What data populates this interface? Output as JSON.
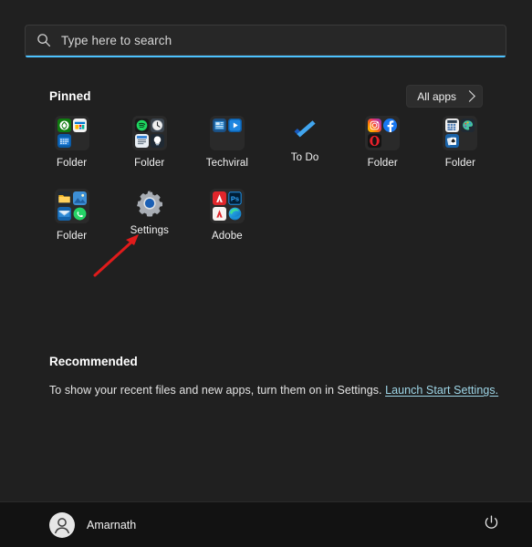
{
  "search": {
    "placeholder": "Type here to search",
    "icon": "search-icon",
    "accent_color": "#4cc2ff"
  },
  "pinned": {
    "title": "Pinned",
    "all_apps_label": "All apps",
    "all_apps_chevron": "chevron-right-icon",
    "tiles": [
      {
        "label": "Folder",
        "type": "folder",
        "icons": [
          "xbox",
          "microsoft-store",
          "calendar"
        ]
      },
      {
        "label": "Folder",
        "type": "folder",
        "icons": [
          "spotify",
          "clock",
          "sticky-notes",
          "tips"
        ]
      },
      {
        "label": "Techviral",
        "type": "folder",
        "icons": [
          "news",
          "media-player"
        ]
      },
      {
        "label": "To Do",
        "type": "app",
        "icon": "microsoft-todo"
      },
      {
        "label": "Folder",
        "type": "folder",
        "icons": [
          "instagram",
          "facebook",
          "opera"
        ]
      },
      {
        "label": "Folder",
        "type": "folder",
        "icons": [
          "calculator",
          "paint",
          "solitaire"
        ]
      },
      {
        "label": "Folder",
        "type": "folder",
        "icons": [
          "file-explorer",
          "photos",
          "mail",
          "whatsapp"
        ]
      },
      {
        "label": "Settings",
        "type": "app",
        "icon": "settings-gear"
      },
      {
        "label": "Adobe",
        "type": "folder",
        "icons": [
          "adobe-acrobat",
          "photoshop",
          "illustrator",
          "edge"
        ]
      }
    ]
  },
  "recommended": {
    "title": "Recommended",
    "empty_text": "To show your recent files and new apps, turn them on in Settings.",
    "link_text": "Launch Start Settings.",
    "link_color": "#9fd7e8"
  },
  "annotation": {
    "arrow": "red-arrow-pointing-to-settings",
    "color": "#e01b1b"
  },
  "bottom_bar": {
    "user_name": "Amarnath",
    "avatar_icon": "user-avatar-icon",
    "power_icon": "power-icon"
  }
}
